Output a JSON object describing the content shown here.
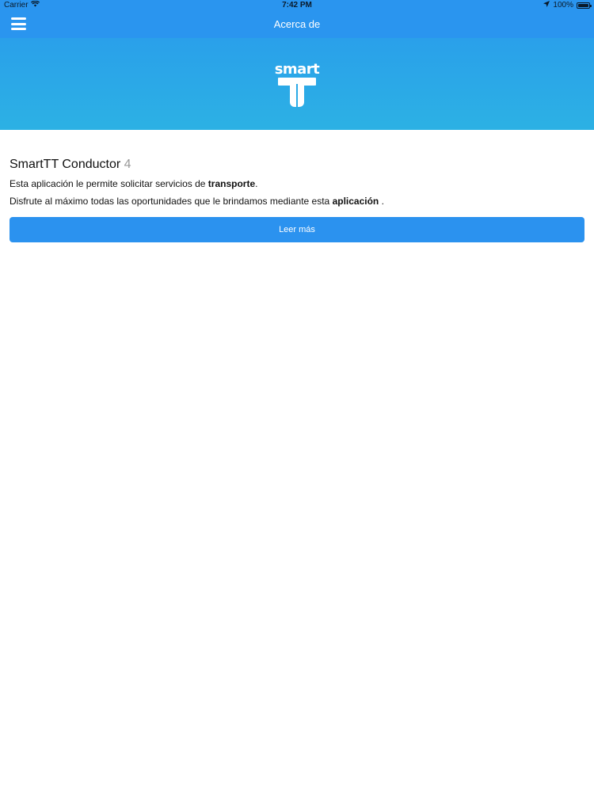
{
  "status_bar": {
    "carrier": "Carrier",
    "time": "7:42 PM",
    "battery": "100%",
    "icons": [
      "wifi-icon",
      "location-arrow-icon",
      "battery-icon"
    ]
  },
  "nav": {
    "title": "Acerca de",
    "menu_icon": "hamburger-menu-icon"
  },
  "banner": {
    "logo_text": "smart",
    "logo_icon": "smart-t-logo",
    "color": "#2aa7e8"
  },
  "about": {
    "app_name": "SmartTT Conductor",
    "version": "4",
    "line1_prefix": "Esta aplicación le permite solicitar servicios de ",
    "line1_bold": "transporte",
    "line1_suffix": ".",
    "line2_prefix": "Disfrute al máximo todas las oportunidades que le brindamos mediante esta ",
    "line2_bold": "aplicación",
    "line2_suffix": " .",
    "read_more_label": "Leer más"
  },
  "colors": {
    "primary": "#2a95ef",
    "banner": "#2aa7e8",
    "version_gray": "#9a9a9a"
  }
}
